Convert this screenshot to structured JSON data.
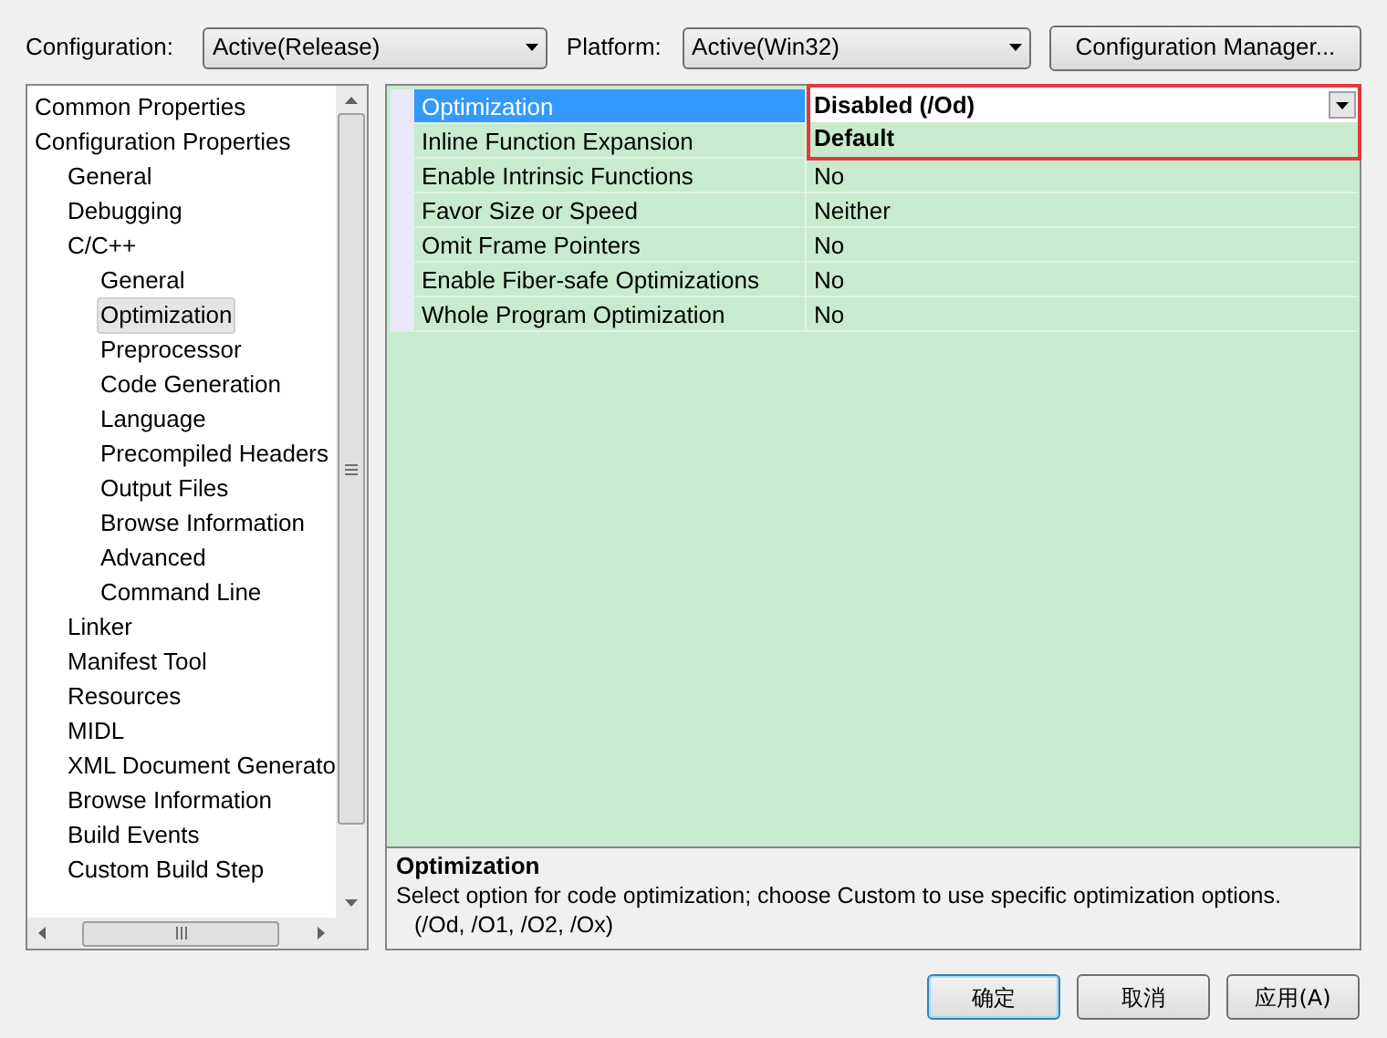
{
  "toolbar": {
    "configuration": {
      "label": "Configuration:",
      "value": "Active(Release)"
    },
    "platform": {
      "label": "Platform:",
      "value": "Active(Win32)"
    },
    "manager_button": "Configuration Manager..."
  },
  "tree": [
    {
      "label": "Common Properties",
      "selected": false
    },
    {
      "label": "Configuration Properties",
      "selected": false,
      "children": [
        {
          "label": "General",
          "selected": false
        },
        {
          "label": "Debugging",
          "selected": false
        },
        {
          "label": "C/C++",
          "selected": false,
          "children": [
            {
              "label": "General",
              "selected": false
            },
            {
              "label": "Optimization",
              "selected": true
            },
            {
              "label": "Preprocessor",
              "selected": false
            },
            {
              "label": "Code Generation",
              "selected": false
            },
            {
              "label": "Language",
              "selected": false
            },
            {
              "label": "Precompiled Headers",
              "selected": false
            },
            {
              "label": "Output Files",
              "selected": false
            },
            {
              "label": "Browse Information",
              "selected": false
            },
            {
              "label": "Advanced",
              "selected": false
            },
            {
              "label": "Command Line",
              "selected": false
            }
          ]
        },
        {
          "label": "Linker",
          "selected": false
        },
        {
          "label": "Manifest Tool",
          "selected": false
        },
        {
          "label": "Resources",
          "selected": false
        },
        {
          "label": "MIDL",
          "selected": false
        },
        {
          "label": "XML Document Generato",
          "selected": false
        },
        {
          "label": "Browse Information",
          "selected": false
        },
        {
          "label": "Build Events",
          "selected": false
        },
        {
          "label": "Custom Build Step",
          "selected": false
        }
      ]
    }
  ],
  "properties": [
    {
      "name": "Optimization",
      "value": "Disabled (/Od)",
      "selected": true,
      "kind": "dropdown",
      "options": [
        "Default"
      ]
    },
    {
      "name": "Inline Function Expansion",
      "selected": false,
      "kind": "text"
    },
    {
      "name": "Enable Intrinsic Functions",
      "value": "No",
      "selected": false,
      "kind": "text"
    },
    {
      "name": "Favor Size or Speed",
      "value": "Neither",
      "selected": false,
      "kind": "text"
    },
    {
      "name": "Omit Frame Pointers",
      "value": "No",
      "selected": false,
      "kind": "text"
    },
    {
      "name": "Enable Fiber-safe Optimizations",
      "value": "No",
      "selected": false,
      "kind": "text"
    },
    {
      "name": "Whole Program Optimization",
      "value": "No",
      "selected": false,
      "kind": "text"
    }
  ],
  "description": {
    "title": "Optimization",
    "text": "Select option for code optimization; choose Custom to use specific optimization options.",
    "text_2": "(/Od, /O1, /O2, /Ox)"
  },
  "buttons": [
    {
      "label": "确定",
      "default": true
    },
    {
      "label": "取消",
      "default": false
    },
    {
      "label": "应用(A)",
      "default": false
    }
  ]
}
